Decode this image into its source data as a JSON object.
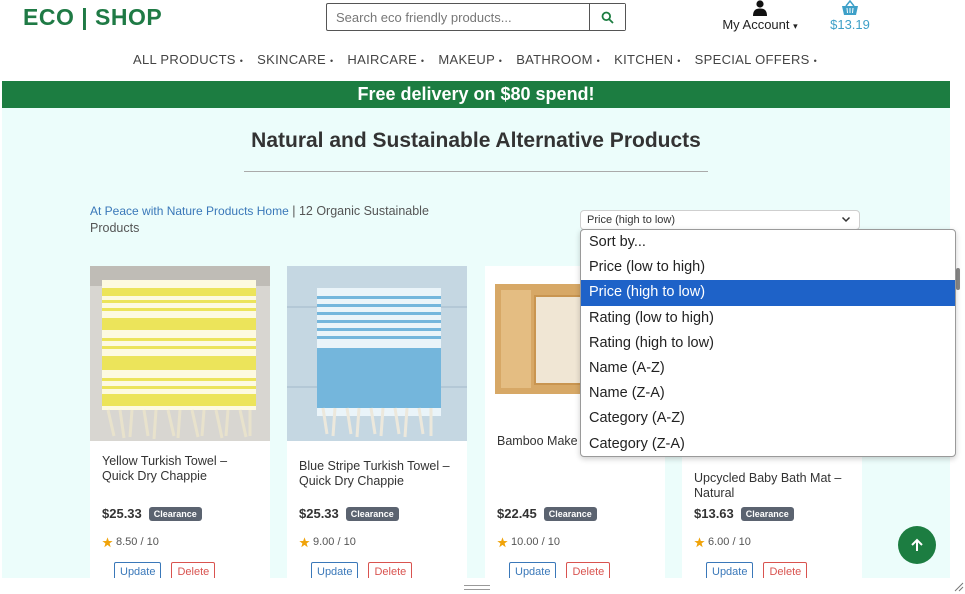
{
  "brand": {
    "logo": "ECO | SHOP",
    "green": "#1c7d41",
    "accent_blue": "#3ea0c8"
  },
  "search": {
    "placeholder": "Search eco friendly products...",
    "value": "",
    "icon": "search-icon"
  },
  "account": {
    "label": "My Account",
    "caret": "▾",
    "icon": "user-icon"
  },
  "cart": {
    "total": "$13.19",
    "icon": "basket-icon"
  },
  "nav": {
    "items": [
      "ALL PRODUCTS",
      "SKINCARE",
      "HAIRCARE",
      "MAKEUP",
      "BATHROOM",
      "KITCHEN",
      "SPECIAL OFFERS"
    ],
    "caret": "•"
  },
  "banner": {
    "text": "Free delivery on $80 spend!"
  },
  "page": {
    "title": "Natural and Sustainable Alternative Products"
  },
  "breadcrumb": {
    "link": "At Peace with Nature Products Home",
    "rest": " | 12 Organic Sustainable Products"
  },
  "sort": {
    "selected": "Price (high to low)",
    "options": [
      "Sort by...",
      "Price (low to high)",
      "Price (high to low)",
      "Rating (low to high)",
      "Rating (high to low)",
      "Name (A-Z)",
      "Name (Z-A)",
      "Category (A-Z)",
      "Category (Z-A)"
    ],
    "highlighted_index": 2
  },
  "products": [
    {
      "name": "Yellow Turkish Towel – Quick Dry Chappie",
      "price": "$25.33",
      "badge": "Clearance",
      "rating": "8.50 / 10",
      "update": "Update",
      "delete": "Delete"
    },
    {
      "name": "Blue Stripe Turkish Towel – Quick Dry Chappie",
      "price": "$25.33",
      "badge": "Clearance",
      "rating": "9.00 / 10",
      "update": "Update",
      "delete": "Delete"
    },
    {
      "name": "Bamboo Make",
      "price": "$22.45",
      "badge": "Clearance",
      "rating": "10.00 / 10",
      "update": "Update",
      "delete": "Delete"
    },
    {
      "name": "Upcycled Baby Bath Mat – Natural",
      "price": "$13.63",
      "badge": "Clearance",
      "rating": "6.00 / 10",
      "update": "Update",
      "delete": "Delete"
    }
  ]
}
